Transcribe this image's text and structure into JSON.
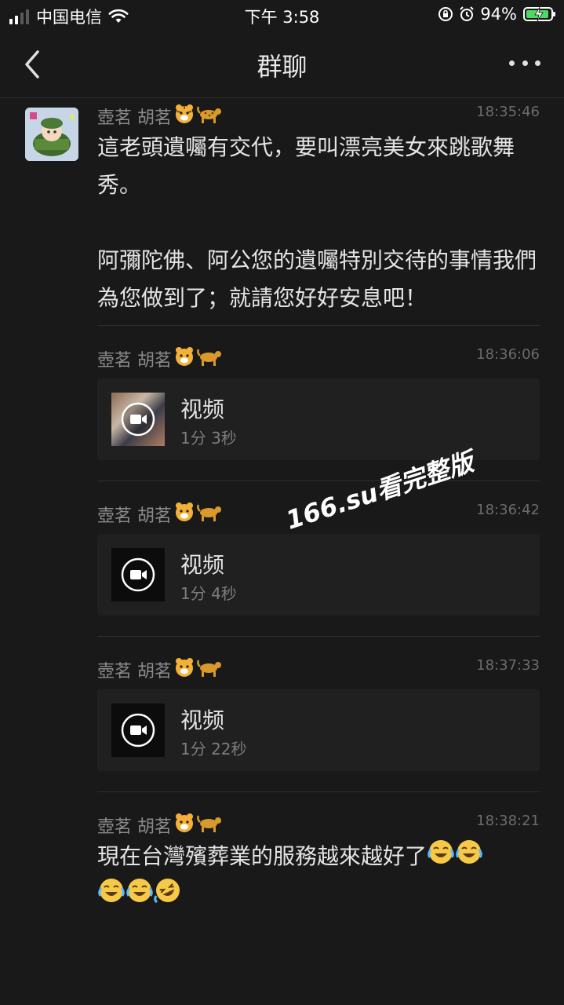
{
  "status_bar": {
    "carrier": "中国电信",
    "time": "下午 3:58",
    "battery": "94%",
    "battery_level": 0.94,
    "signal_bars": 4,
    "signal_active": 2
  },
  "nav": {
    "title": "群聊"
  },
  "sender_name": "壺茗 胡茗",
  "sender_emojis": [
    "tiger-face-icon",
    "leopard-icon"
  ],
  "messages": [
    {
      "type": "text",
      "time": "18:35:46",
      "text": "這老頭遺囑有交代，要叫漂亮美女來跳歌舞秀。\n\n阿彌陀佛、阿公您的遺囑特別交待的事情我們為您做到了；就請您好好安息吧！"
    },
    {
      "type": "video",
      "time": "18:36:06",
      "label": "视频",
      "duration": "1分 3秒",
      "thumb": "photo"
    },
    {
      "type": "video",
      "time": "18:36:42",
      "label": "视频",
      "duration": "1分 4秒",
      "thumb": "black"
    },
    {
      "type": "video",
      "time": "18:37:33",
      "label": "视频",
      "duration": "1分 22秒",
      "thumb": "black"
    },
    {
      "type": "text",
      "time": "18:38:21",
      "text": "現在台灣殯葬業的服務越來越好了",
      "trailing_emojis": [
        "crying-laughing-icon",
        "crying-laughing-icon",
        "crying-laughing-icon",
        "crying-laughing-icon",
        "rolling-laughing-icon"
      ]
    }
  ],
  "watermark": "166.su看完整版",
  "colors": {
    "background": "#191919",
    "card": "#202020",
    "battery": "#4cd964"
  }
}
